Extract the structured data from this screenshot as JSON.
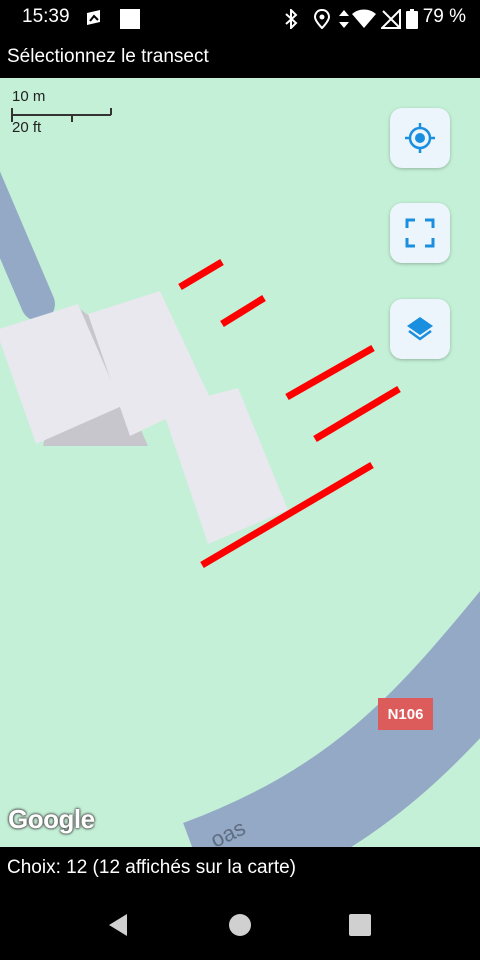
{
  "status_bar": {
    "time": "15:39",
    "battery_percent": "79 %",
    "icons": [
      "gallery-icon",
      "notification-square-icon",
      "bluetooth-icon",
      "location-icon",
      "data-transfer-icon",
      "wifi-icon",
      "no-sim-icon",
      "battery-icon"
    ]
  },
  "title_bar": {
    "title": "Sélectionnez le transect"
  },
  "map": {
    "scale": {
      "metric": "10 m",
      "imperial": "20 ft"
    },
    "road_label": "N106",
    "attribution": "Google",
    "buttons": [
      "my-location",
      "fullscreen",
      "layers"
    ],
    "transect_count": 5,
    "colors": {
      "land": "#c3f0d6",
      "road": "#94a9c6",
      "building": "#e8e8ee",
      "transect": "#ff0000",
      "button_accent": "#1a8fe0"
    }
  },
  "footer": {
    "text": "Choix: 12 (12 affichés sur la carte)"
  },
  "nav_bar": {
    "buttons": [
      "back",
      "home",
      "recents"
    ]
  }
}
